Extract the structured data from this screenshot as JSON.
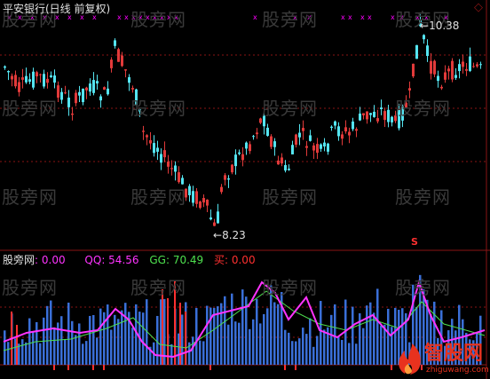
{
  "colors": {
    "background": "#000000",
    "up_candle": "#e23a3a",
    "down_candle": "#54e4f0",
    "text_white": "#e0e0e0",
    "qq_line": "#ff33ff",
    "gg_line": "#4ee04e",
    "buy_red": "#ff3030",
    "histogram": "#3a6fd8",
    "grid_red": "#8a1515",
    "marker_magenta": "#ff00ff",
    "brand_red": "#e8321e"
  },
  "price_panel": {
    "title": "平安银行(日线 前复权)",
    "high_label": "10.38",
    "low_label": "8.23",
    "cross_marker": "x",
    "signal_marker": "S",
    "corner_icon": "diamond-icon"
  },
  "indicator_panel": {
    "name": "股旁网",
    "name_value": ": 0.00",
    "qq_label": "QQ: 54.56",
    "gg_label": "GG: 70.49",
    "buy_label": "买: 0.00"
  },
  "watermark": {
    "text": "股旁网"
  },
  "logo": {
    "text": "智股网",
    "url_text": "zhiguwang.com",
    "icon": "flame-icon"
  }
}
